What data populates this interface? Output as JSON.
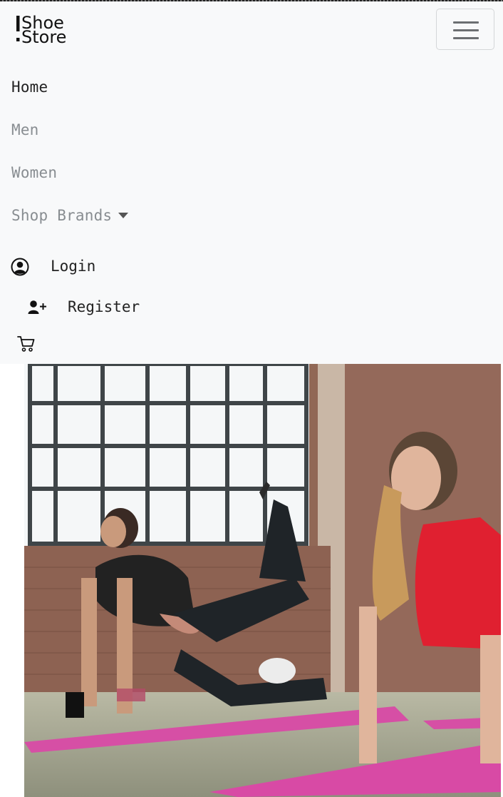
{
  "brand": {
    "line1": "Shoe",
    "line2": "Store"
  },
  "nav": {
    "items": [
      {
        "label": "Home"
      },
      {
        "label": "Men"
      },
      {
        "label": "Women"
      },
      {
        "label": "Shop Brands"
      }
    ]
  },
  "auth": {
    "login_label": "Login",
    "register_label": "Register"
  },
  "icons": {
    "menu": "hamburger-icon",
    "login": "user-circle-icon",
    "register": "user-plus-icon",
    "cart": "cart-icon",
    "dropdown": "caret-down-icon"
  },
  "colors": {
    "navbar_bg": "#f8f9fa",
    "active_link": "#222222",
    "inactive_link": "#888d91",
    "mat_pink": "#d64fa5",
    "top_red": "#e02030"
  }
}
